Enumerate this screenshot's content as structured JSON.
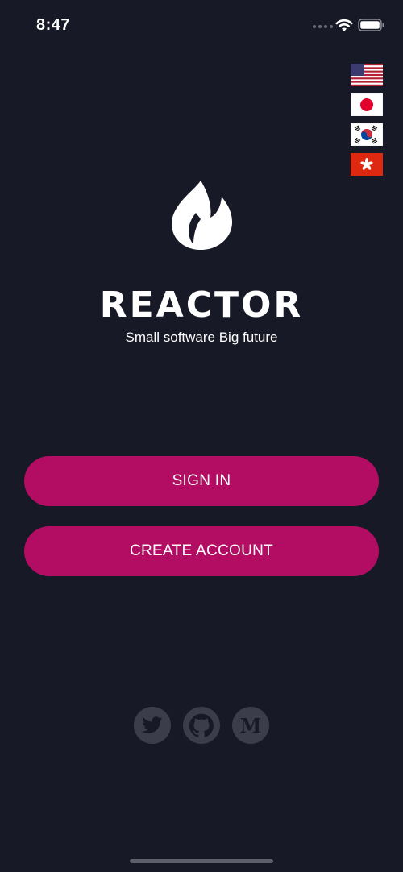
{
  "status_bar": {
    "time": "8:47",
    "icons": [
      "signal-dots-icon",
      "wifi-icon",
      "battery-icon"
    ]
  },
  "language_flags": [
    {
      "name": "us-flag",
      "country": "United States"
    },
    {
      "name": "japan-flag",
      "country": "Japan"
    },
    {
      "name": "korea-flag",
      "country": "South Korea"
    },
    {
      "name": "hong-kong-flag",
      "country": "Hong Kong"
    }
  ],
  "brand": {
    "logo_icon": "flame-icon",
    "title": "REACTOR",
    "tagline": "Small software Big future"
  },
  "actions": {
    "sign_in_label": "SIGN IN",
    "create_account_label": "CREATE ACCOUNT"
  },
  "social": {
    "items": [
      "twitter-icon",
      "github-icon",
      "medium-icon"
    ],
    "medium_letter": "M"
  },
  "colors": {
    "background": "#181926",
    "accent": "#b30d63",
    "social_button": "#3c3d4b",
    "text": "#ffffff"
  }
}
